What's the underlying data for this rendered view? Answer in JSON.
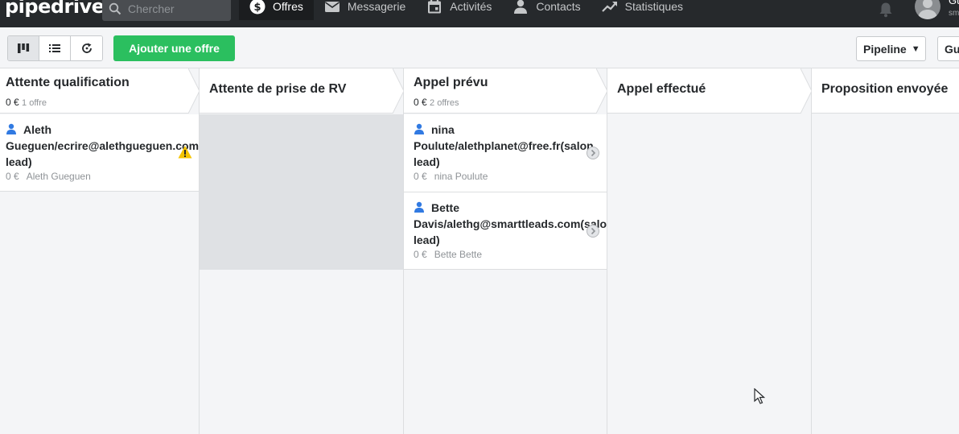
{
  "app": {
    "logo": "pipedrive",
    "search_placeholder": "Chercher"
  },
  "nav": [
    {
      "label": "Offres",
      "icon": "dollar-icon",
      "active": true
    },
    {
      "label": "Messagerie",
      "icon": "mail-icon",
      "active": false
    },
    {
      "label": "Activités",
      "icon": "calendar-icon",
      "active": false
    },
    {
      "label": "Contacts",
      "icon": "person-icon",
      "active": false
    },
    {
      "label": "Statistiques",
      "icon": "trend-icon",
      "active": false
    }
  ],
  "user": {
    "name": "Gu",
    "sub": "sm"
  },
  "toolbar": {
    "add_label": "Ajouter une offre",
    "pipeline_label": "Pipeline",
    "user_filter_label": "Gu"
  },
  "stages": [
    {
      "title": "Attente qualification",
      "amount": "0 €",
      "count": "1 offre"
    },
    {
      "title": "Attente de prise de RV",
      "amount": "",
      "count": ""
    },
    {
      "title": "Appel prévu",
      "amount": "0 €",
      "count": "2 offres"
    },
    {
      "title": "Appel effectué",
      "amount": "",
      "count": ""
    },
    {
      "title": "Proposition envoyée",
      "amount": "",
      "count": ""
    }
  ],
  "deals": {
    "stage0": [
      {
        "title_line1": "Aleth",
        "title_line2": "Gueguen/ecrire@alethgueguen.com",
        "title_line3": "lead)",
        "value": "0 €",
        "person": "Aleth Gueguen",
        "status_icon": "warning-icon"
      }
    ],
    "stage2": [
      {
        "title_line1": "nina",
        "title_line2": "Poulute/alethplanet@free.fr(salon",
        "title_line3": "lead)",
        "value": "0 €",
        "person": "nina Poulute",
        "status_icon": "chevron-circle-icon"
      },
      {
        "title_line1": "Bette",
        "title_line2": "Davis/alethg@smarttleads.com(salon",
        "title_line3": "lead)",
        "value": "0 €",
        "person": "Bette Bette",
        "status_icon": "chevron-circle-icon"
      }
    ]
  },
  "colors": {
    "topbar": "#26292c",
    "accent_green": "#2bbf5f",
    "board_bg": "#f4f5f7",
    "warning": "#f5c400"
  }
}
